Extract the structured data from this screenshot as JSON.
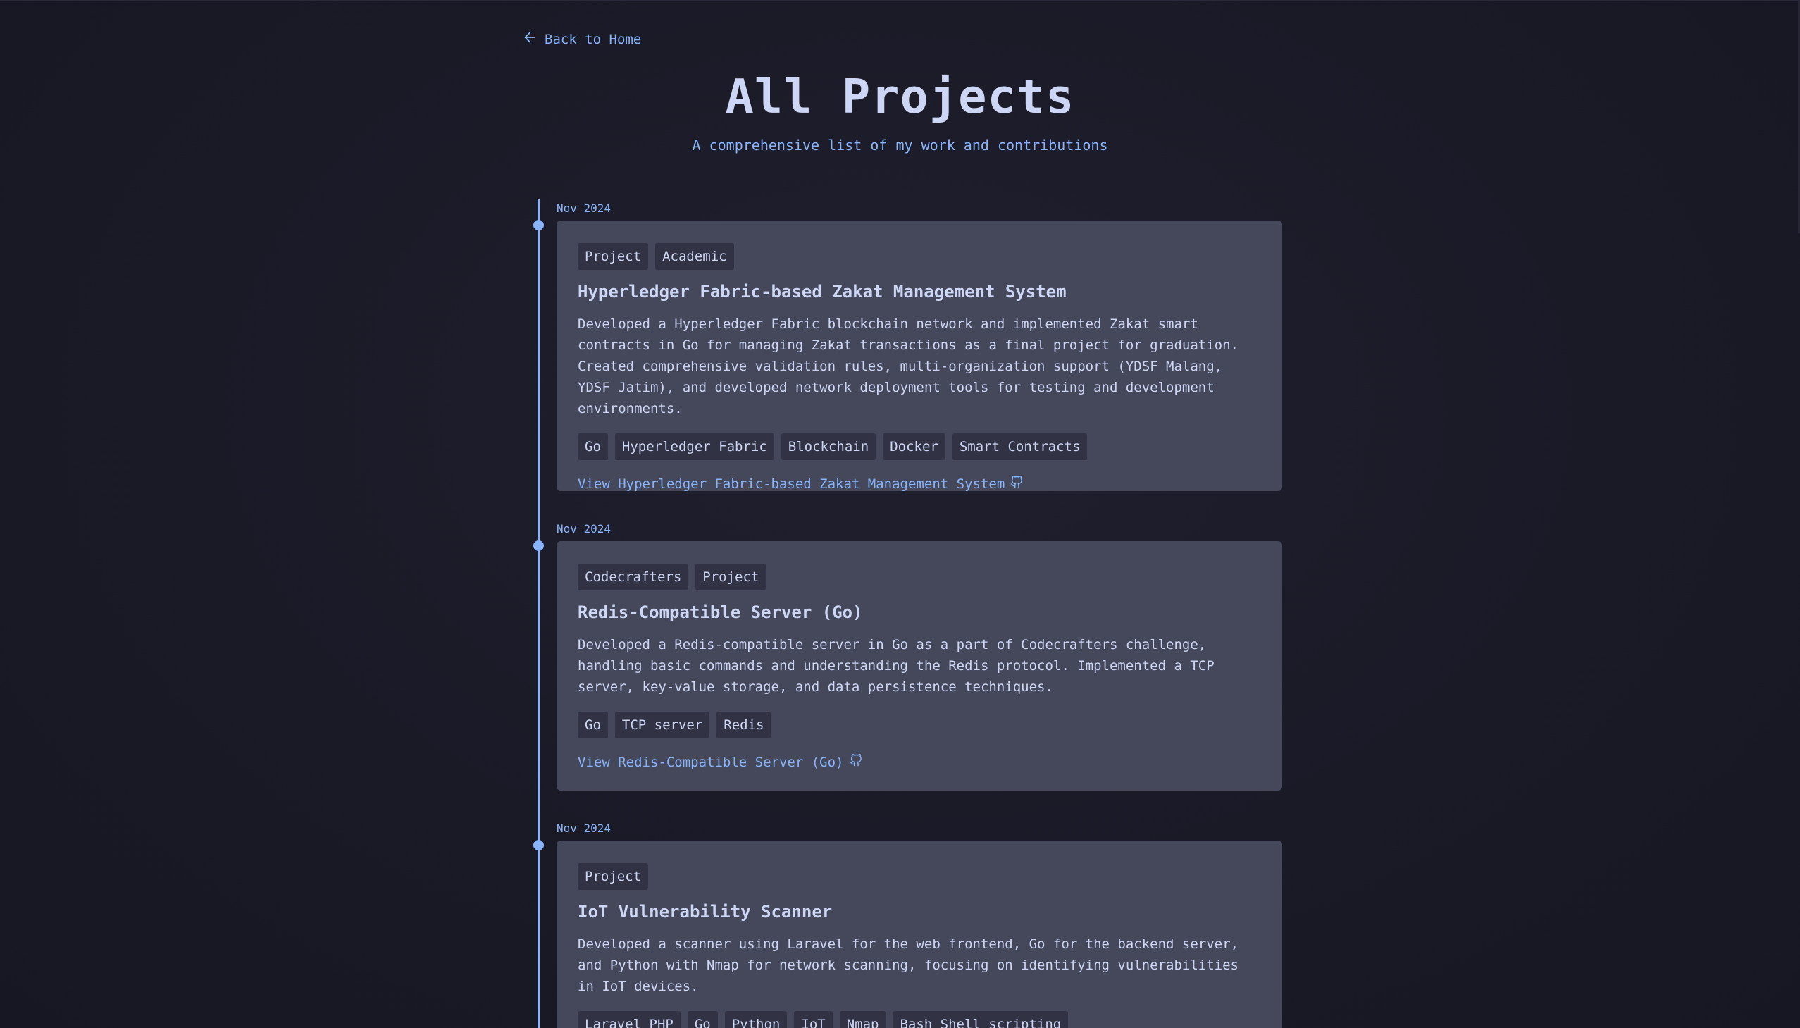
{
  "nav": {
    "back_label": "Back to Home",
    "back_icon": "arrow-left-icon"
  },
  "header": {
    "title": "All Projects",
    "subtitle": "A comprehensive list of my work and contributions"
  },
  "colors": {
    "background": "#1a1a27",
    "card": "#45475a",
    "chip": "#313244",
    "accent": "#89b4fa",
    "text": "#cdd6f4"
  },
  "projects": [
    {
      "date": "Nov 2024",
      "badges": [
        "Project",
        "Academic"
      ],
      "title": "Hyperledger Fabric-based Zakat Management System",
      "description": "Developed a Hyperledger Fabric blockchain network and implemented Zakat smart contracts in Go for managing Zakat transactions as a final project for graduation. Created comprehensive validation rules, multi-organization support (YDSF Malang, YDSF Jatim), and developed network deployment tools for testing and development environments.",
      "tags": [
        "Go",
        "Hyperledger Fabric",
        "Blockchain",
        "Docker",
        "Smart Contracts"
      ],
      "link_label": "View Hyperledger Fabric-based Zakat Management System",
      "link_icon": "github-icon"
    },
    {
      "date": "Nov 2024",
      "badges": [
        "Codecrafters",
        "Project"
      ],
      "title": "Redis-Compatible Server (Go)",
      "description": "Developed a Redis-compatible server in Go as a part of Codecrafters challenge, handling basic commands and understanding the Redis protocol. Implemented a TCP server, key-value storage, and data persistence techniques.",
      "tags": [
        "Go",
        "TCP server",
        "Redis"
      ],
      "link_label": "View Redis-Compatible Server (Go)",
      "link_icon": "github-icon"
    },
    {
      "date": "Nov 2024",
      "badges": [
        "Project"
      ],
      "title": "IoT Vulnerability Scanner",
      "description": "Developed a scanner using Laravel for the web frontend, Go for the backend server, and Python with Nmap for network scanning, focusing on identifying vulnerabilities in IoT devices.",
      "tags": [
        "Laravel PHP",
        "Go",
        "Python",
        "IoT",
        "Nmap",
        "Bash Shell scripting"
      ]
    }
  ]
}
